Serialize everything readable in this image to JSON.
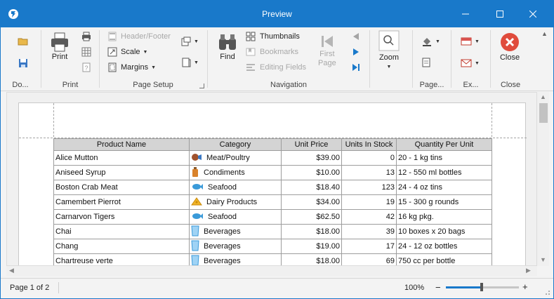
{
  "window": {
    "title": "Preview",
    "controls": {
      "minimize": "minimize",
      "maximize": "maximize",
      "close": "close"
    }
  },
  "ribbon": {
    "document": {
      "label": "Do...",
      "icons": [
        "open-icon",
        "save-icon"
      ]
    },
    "print": {
      "label": "Print",
      "print_button": "Print",
      "icons": [
        "quick-print-icon",
        "print-options-icon",
        "parameters-icon"
      ]
    },
    "page_setup": {
      "label": "Page Setup",
      "header_footer": "Header/Footer",
      "scale": "Scale",
      "margins": "Margins"
    },
    "navigation": {
      "label": "Navigation",
      "find": "Find",
      "thumbnails": "Thumbnails",
      "bookmarks": "Bookmarks",
      "editing_fields": "Editing Fields",
      "first_page_line1": "First",
      "first_page_line2": "Page"
    },
    "zoom": {
      "label": "Zoom"
    },
    "page_background": {
      "label": "Page..."
    },
    "export": {
      "label": "Ex..."
    },
    "close": {
      "label": "Close",
      "button": "Close"
    }
  },
  "report": {
    "columns": [
      "Product Name",
      "Category",
      "Unit Price",
      "Units In Stock",
      "Quantity Per Unit"
    ],
    "rows": [
      {
        "product": "Alice Mutton",
        "category": "Meat/Poultry",
        "icon": "meat-icon",
        "price": "$39.00",
        "stock": "0",
        "qty": "20 - 1 kg tins"
      },
      {
        "product": "Aniseed Syrup",
        "category": "Condiments",
        "icon": "condiments-icon",
        "price": "$10.00",
        "stock": "13",
        "qty": "12 - 550 ml bottles"
      },
      {
        "product": "Boston Crab Meat",
        "category": "Seafood",
        "icon": "seafood-icon",
        "price": "$18.40",
        "stock": "123",
        "qty": "24 - 4 oz tins"
      },
      {
        "product": "Camembert Pierrot",
        "category": "Dairy Products",
        "icon": "dairy-icon",
        "price": "$34.00",
        "stock": "19",
        "qty": "15 - 300 g rounds"
      },
      {
        "product": "Carnarvon Tigers",
        "category": "Seafood",
        "icon": "seafood-icon",
        "price": "$62.50",
        "stock": "42",
        "qty": "16 kg pkg."
      },
      {
        "product": "Chai",
        "category": "Beverages",
        "icon": "beverages-icon",
        "price": "$18.00",
        "stock": "39",
        "qty": "10 boxes x 20 bags"
      },
      {
        "product": "Chang",
        "category": "Beverages",
        "icon": "beverages-icon",
        "price": "$19.00",
        "stock": "17",
        "qty": "24 - 12 oz bottles"
      },
      {
        "product": "Chartreuse verte",
        "category": "Beverages",
        "icon": "beverages-icon",
        "price": "$18.00",
        "stock": "69",
        "qty": "750 cc per bottle"
      }
    ]
  },
  "status": {
    "page_info": "Page 1 of 2",
    "zoom_level": "100%",
    "zoom_minus": "−",
    "zoom_plus": "+",
    "zoom_slider_fraction": 0.5
  },
  "colors": {
    "accent": "#1979ca",
    "close_red": "#e04b3c",
    "header_gray": "#d4d4d4"
  }
}
